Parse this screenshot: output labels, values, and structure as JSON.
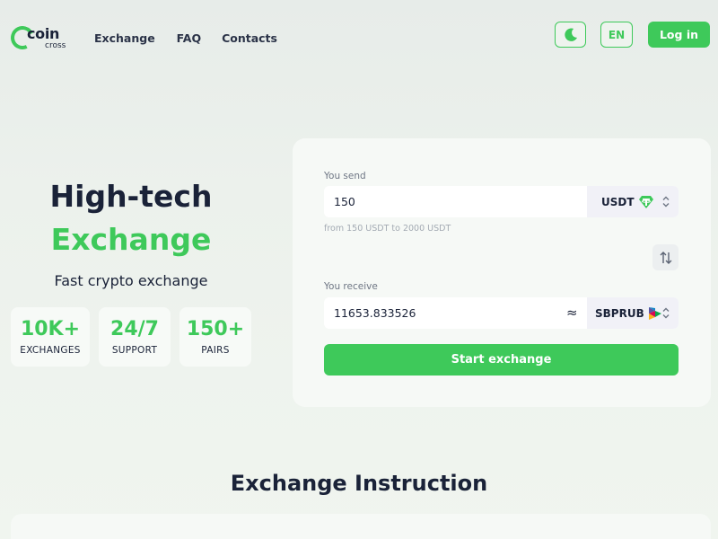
{
  "header": {
    "logo_main": "coin",
    "logo_sub": "cross",
    "nav": [
      "Exchange",
      "FAQ",
      "Contacts"
    ],
    "lang": "EN",
    "login": "Log in"
  },
  "hero": {
    "title_line1": "High-tech",
    "title_line2": "Exchange",
    "subtitle": "Fast crypto exchange",
    "stats": [
      {
        "value": "10K+",
        "label": "EXCHANGES"
      },
      {
        "value": "24/7",
        "label": "SUPPORT"
      },
      {
        "value": "150+",
        "label": "PAIRS"
      }
    ]
  },
  "exchange": {
    "send_label": "You send",
    "send_value": "150",
    "send_currency": "USDT",
    "limit_hint": "from 150 USDT to 2000 USDT",
    "receive_label": "You receive",
    "receive_value": "11653.833526",
    "approx_symbol": "≈",
    "receive_currency": "SBPRUB",
    "start_button": "Start exchange"
  },
  "instruction": {
    "title": "Exchange Instruction"
  },
  "colors": {
    "accent": "#3ec95a",
    "text_dark": "#1a2238",
    "card_bg": "#f6f9f6",
    "tether": "#3ec95a"
  }
}
